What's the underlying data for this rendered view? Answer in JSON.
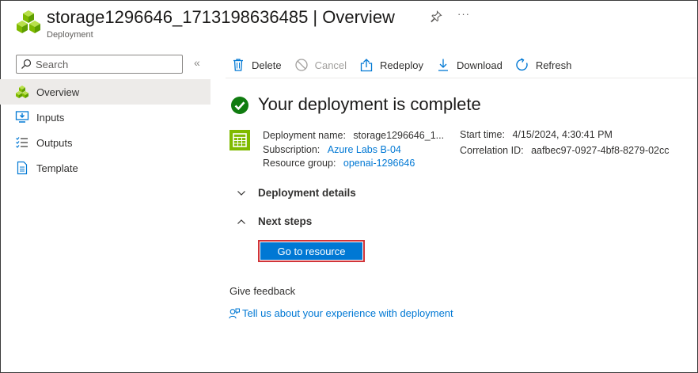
{
  "header": {
    "title": "storage1296646_1713198636485 | Overview",
    "subtitle": "Deployment",
    "more": "···"
  },
  "sidebar": {
    "search_placeholder": "Search",
    "collapse": "«",
    "items": [
      {
        "label": "Overview",
        "icon": "overview-icon"
      },
      {
        "label": "Inputs",
        "icon": "inputs-icon"
      },
      {
        "label": "Outputs",
        "icon": "outputs-icon"
      },
      {
        "label": "Template",
        "icon": "template-icon"
      }
    ]
  },
  "toolbar": {
    "delete": "Delete",
    "cancel": "Cancel",
    "redeploy": "Redeploy",
    "download": "Download",
    "refresh": "Refresh"
  },
  "main": {
    "heading": "Your deployment is complete",
    "deployment_name_label": "Deployment name:",
    "deployment_name": "storage1296646_1...",
    "subscription_label": "Subscription:",
    "subscription": "Azure Labs B-04",
    "resource_group_label": "Resource group:",
    "resource_group": "openai-1296646",
    "start_time_label": "Start time:",
    "start_time": "4/15/2024, 4:30:41 PM",
    "correlation_label": "Correlation ID:",
    "correlation_id": "aafbec97-0927-4bf8-8279-02cc",
    "deployment_details": "Deployment details",
    "next_steps": "Next steps",
    "go_to_resource": "Go to resource",
    "feedback_label": "Give feedback",
    "feedback_link": "Tell us about your experience with deployment"
  },
  "colors": {
    "accent": "#0078d4",
    "success": "#107c10",
    "highlight_border": "#d13438",
    "resource_icon": "#7fba00"
  }
}
